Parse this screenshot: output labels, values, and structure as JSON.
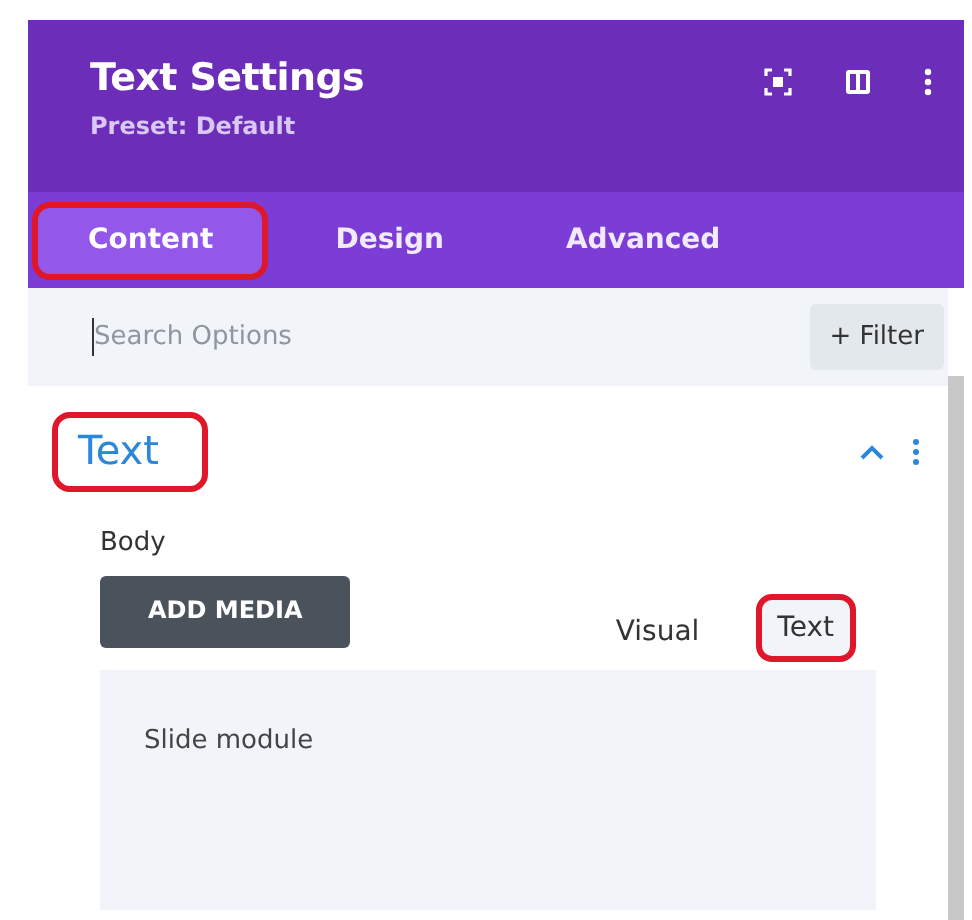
{
  "header": {
    "title": "Text Settings",
    "preset": "Preset: Default"
  },
  "tabs": [
    {
      "label": "Content",
      "selected": true,
      "highlighted": true
    },
    {
      "label": "Design",
      "selected": false,
      "highlighted": false
    },
    {
      "label": "Advanced",
      "selected": false,
      "highlighted": false
    }
  ],
  "search": {
    "placeholder": "Search Options",
    "filter_label": "+ Filter"
  },
  "section": {
    "title": "Text",
    "expanded": true,
    "highlighted": true,
    "field_label": "Body",
    "add_media": "ADD MEDIA",
    "editor_tabs": [
      {
        "label": "Visual",
        "selected": false,
        "highlighted": false
      },
      {
        "label": "Text",
        "selected": true,
        "highlighted": true
      }
    ],
    "content": "Slide module"
  }
}
